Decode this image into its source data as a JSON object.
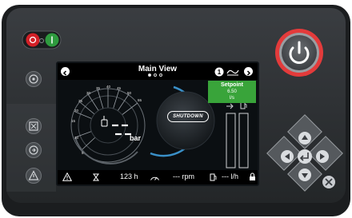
{
  "screen": {
    "title": "Main View",
    "page_dots": 3,
    "active_page": 1,
    "setpoint_label": "Setpoint",
    "setpoint_value": "6.50",
    "setpoint_unit": "l/s",
    "status_badge": "SHUTDOWN",
    "pressure_unit": "bar",
    "gauge_ticks": [
      "5",
      "10",
      "15",
      "20",
      "25",
      "30",
      "35",
      "40",
      "45",
      "50",
      "55"
    ],
    "hours_value": "123 h",
    "rpm_value": "--- rpm",
    "fuel_rate_value": "--- l/h"
  },
  "colors": {
    "panel": "#2a2d30",
    "setpoint_bg": "#39a43a",
    "start_button": "#2e9b3e",
    "stop_button": "#d32027",
    "power_ring": "#e33b3b"
  },
  "icons": {
    "start": "start-power-icon",
    "stop": "stop-power-icon",
    "nav": [
      "up-arrow-icon",
      "left-arrow-icon",
      "enter-icon",
      "right-arrow-icon",
      "down-arrow-icon",
      "close-icon"
    ]
  }
}
